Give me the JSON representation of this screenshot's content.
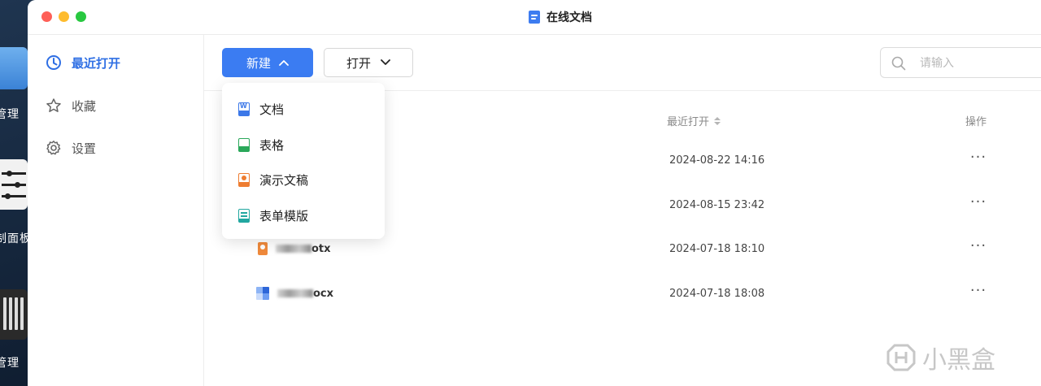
{
  "desktop": {
    "labels": [
      "管理",
      "制面板",
      "管理"
    ]
  },
  "window": {
    "title": "在线文档"
  },
  "sidebar": {
    "items": [
      {
        "label": "最近打开",
        "icon": "clock-icon",
        "active": true
      },
      {
        "label": "收藏",
        "icon": "star-icon",
        "active": false
      },
      {
        "label": "设置",
        "icon": "gear-icon",
        "active": false
      }
    ]
  },
  "toolbar": {
    "new_label": "新建",
    "open_label": "打开",
    "search_placeholder": "请输入"
  },
  "table": {
    "col_recent": "最近打开",
    "col_actions": "操作",
    "rows": [
      {
        "name": "",
        "date": "2024-08-22 14:16",
        "more": "···"
      },
      {
        "name": "",
        "date": "2024-08-15 23:42",
        "more": "···"
      },
      {
        "name": "otx",
        "date": "2024-07-18 18:10",
        "more": "···",
        "icon": "presentation-file-icon"
      },
      {
        "name": "ocx",
        "date": "2024-07-18 18:08",
        "more": "···",
        "icon": "document-file-icon"
      }
    ]
  },
  "new_menu": {
    "items": [
      {
        "label": "文档",
        "icon": "word-doc-icon"
      },
      {
        "label": "表格",
        "icon": "spreadsheet-icon"
      },
      {
        "label": "演示文稿",
        "icon": "presentation-icon"
      },
      {
        "label": "表单模版",
        "icon": "form-template-icon"
      }
    ]
  },
  "watermark": {
    "text": "小黑盒"
  },
  "colors": {
    "accent": "#3b7cf2",
    "active_nav": "#2f6fe4"
  }
}
